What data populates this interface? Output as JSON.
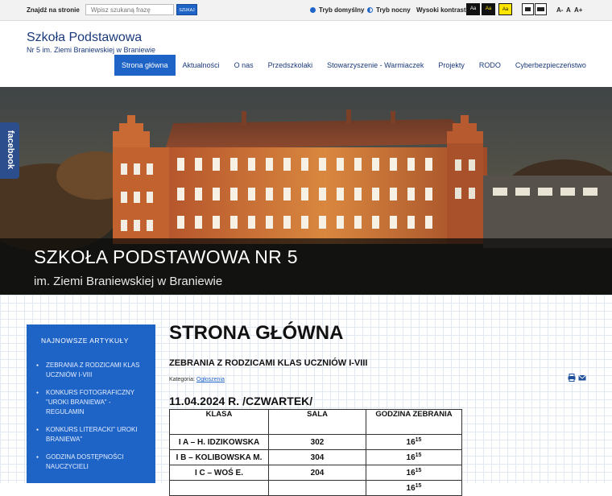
{
  "topbar": {
    "search_label": "Znajdź na stronie",
    "search_placeholder": "Wpisz szukaną frazę",
    "search_button": "SZUKAJ",
    "mode_default": "Tryb domyślny",
    "mode_night": "Tryb nocny",
    "high_contrast_label": "Wysoki kontrast",
    "contrast_options": [
      "Aa",
      "Aa",
      "Aa"
    ],
    "font_sizes": [
      "A-",
      "A",
      "A+"
    ]
  },
  "header": {
    "title": "Szkoła Podstawowa",
    "subtitle": "Nr 5 im. Ziemi Braniewskiej w Braniewie"
  },
  "nav": {
    "items": [
      "Strona główna",
      "Aktualności",
      "O nas",
      "Przedszkolaki",
      "Stowarzyszenie - Warmiaczek",
      "Projekty",
      "RODO",
      "Cyberbezpieczeństwo"
    ],
    "active_index": 0
  },
  "hero": {
    "title": "SZKOŁA PODSTAWOWA NR 5",
    "subtitle": "im. Ziemi Braniewskiej w Braniewie",
    "facebook_label": "facebook"
  },
  "sidebar": {
    "heading": "NAJNOWSZE ARTYKUŁY",
    "items": [
      "ZEBRANIA Z RODZICAMI KLAS UCZNIÓW I-VIII",
      "KONKURS FOTOGRAFICZNY \"UROKI BRANIEWA\" - REGULAMIN",
      "KONKURS LITERACKI\" UROKI BRANIEWA\"",
      "GODZINA DOSTĘPNOŚCI NAUCZYCIELI"
    ]
  },
  "main": {
    "page_title": "STRONA GŁÓWNA",
    "article_title": "ZEBRANIA Z RODZICAMI KLAS UCZNIÓW I-VIII",
    "category_label": "Kategoria:",
    "category_value": "Ogłoszenia",
    "date_heading": "11.04.2024 R. /CZWARTEK/",
    "table": {
      "headers": [
        "KLASA",
        "SALA",
        "GODZINA ZEBRANIA"
      ],
      "rows": [
        {
          "klasa": "I A – H. IDZIKOWSKA",
          "sala": "302",
          "hour": "16",
          "minutes": "15"
        },
        {
          "klasa": "I B – KOLIBOWSKA M.",
          "sala": "304",
          "hour": "16",
          "minutes": "15"
        },
        {
          "klasa": "I C – WOŚ E.",
          "sala": "204",
          "hour": "16",
          "minutes": "15"
        },
        {
          "klasa": "",
          "sala": "",
          "hour": "16",
          "minutes": "15"
        }
      ]
    }
  },
  "colors": {
    "accent": "#1e63c6",
    "title_blue": "#1a3a7a",
    "facebook": "#2d4e8c"
  }
}
